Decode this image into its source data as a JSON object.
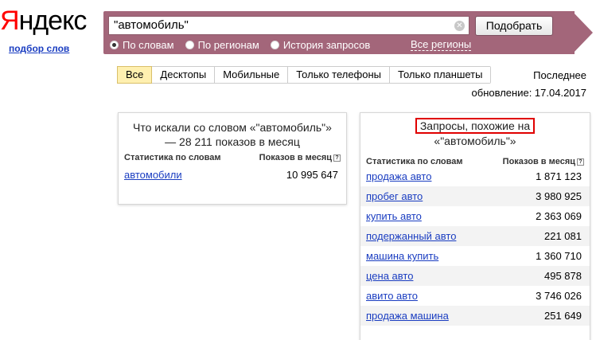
{
  "logo": {
    "first_letter": "Я",
    "rest": "ндекс",
    "subtitle": "подбор слов"
  },
  "search": {
    "value": "\"автомобиль\"",
    "button": "Подобрать"
  },
  "radios": [
    {
      "label": "По словам",
      "checked": true
    },
    {
      "label": "По регионам",
      "checked": false
    },
    {
      "label": "История запросов",
      "checked": false
    }
  ],
  "all_regions": "Все регионы",
  "tabs": [
    {
      "label": "Все",
      "active": true
    },
    {
      "label": "Десктопы",
      "active": false
    },
    {
      "label": "Мобильные",
      "active": false
    },
    {
      "label": "Только телефоны",
      "active": false
    },
    {
      "label": "Только планшеты",
      "active": false
    }
  ],
  "updated": {
    "line1": "Последнее",
    "line2": "обновление: 17.04.2017"
  },
  "left_panel": {
    "title": "Что искали со словом «\"автомобиль\"» — 28 211 показов в месяц",
    "col1": "Статистика по словам",
    "col2": "Показов в месяц",
    "rows": [
      {
        "word": "автомобили",
        "count": "10 995 647"
      }
    ]
  },
  "right_panel": {
    "title_line1": "Запросы, похожие на",
    "title_line2": "«\"автомобиль\"»",
    "col1": "Статистика по словам",
    "col2": "Показов в месяц",
    "rows": [
      {
        "word": "продажа авто",
        "count": "1 871 123"
      },
      {
        "word": "пробег авто",
        "count": "3 980 925"
      },
      {
        "word": "купить авто",
        "count": "2 363 069"
      },
      {
        "word": "подержанный авто",
        "count": "221 081"
      },
      {
        "word": "машина купить",
        "count": "1 360 710"
      },
      {
        "word": "цена авто",
        "count": "495 878"
      },
      {
        "word": "авито авто",
        "count": "3 746 026"
      },
      {
        "word": "продажа машина",
        "count": "251 649"
      }
    ]
  },
  "colors": {
    "header_bar": "#a3667a",
    "link": "#1a3dc1",
    "highlight": "#e00000",
    "active_tab": "#fff0b0"
  }
}
